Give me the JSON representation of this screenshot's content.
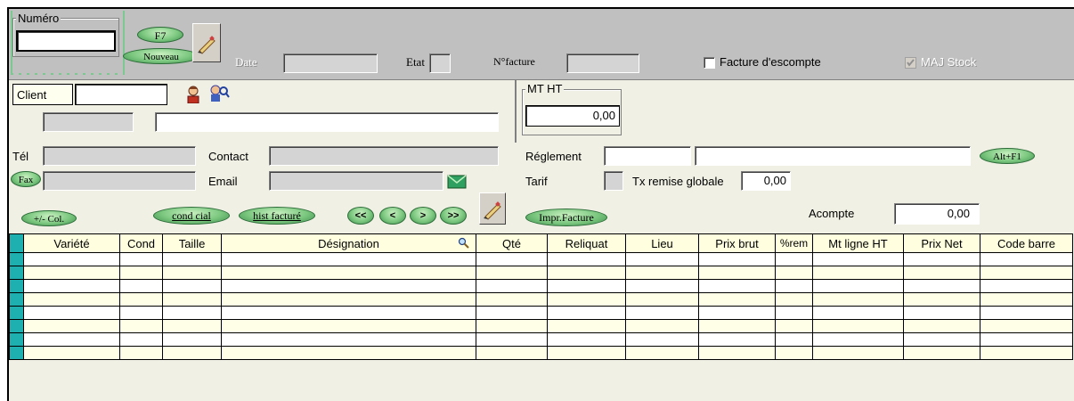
{
  "header": {
    "numero_label": "Numéro",
    "numero_value": "",
    "f7_label": "F7",
    "nouveau_label": "Nouveau",
    "date_label": "Date",
    "date_value": "",
    "etat_label": "Etat",
    "nfacture_label": "N°facture",
    "nfacture_value": "",
    "facture_escompte_label": "Facture d'escompte",
    "maj_stock_label": "MAJ Stock"
  },
  "client": {
    "client_label": "Client",
    "client_value": "",
    "code_value": "",
    "name_value": "",
    "tel_label": "Tél",
    "tel_value": "",
    "contact_label": "Contact",
    "contact_value": "",
    "fax_label": "Fax",
    "fax_value": "",
    "email_label": "Email",
    "email_value": ""
  },
  "totals": {
    "mt_ht_label": "MT HT",
    "mt_ht_value": "0,00",
    "reglement_label": "Réglement",
    "reglement_code": "",
    "reglement_desc": "",
    "altf1_label": "Alt+F1",
    "tarif_label": "Tarif",
    "tx_remise_label": "Tx remise globale",
    "tx_remise_value": "0,00",
    "acompte_label": "Acompte",
    "acompte_value": "0,00"
  },
  "actions": {
    "col_label": "+/- Col.",
    "cond_cial_label": "cond cial",
    "hist_facture_label": "hist facturé",
    "first_label": "<<",
    "prev_label": "<",
    "next_label": ">",
    "last_label": ">>",
    "impr_facture_label": "Impr.Facture"
  },
  "grid": {
    "columns": [
      "Variété",
      "Cond",
      "Taille",
      "Désignation",
      "Qté",
      "Reliquat",
      "Lieu",
      "Prix brut",
      "%rem",
      "Mt ligne HT",
      "Prix Net",
      "Code barre"
    ],
    "row_count": 8
  },
  "colors": {
    "accent_teal": "#1eb0b0",
    "pill_green": "#7cc880",
    "panel_bg": "#f0f0e4",
    "toolbar_bg": "#c0c0c0"
  }
}
